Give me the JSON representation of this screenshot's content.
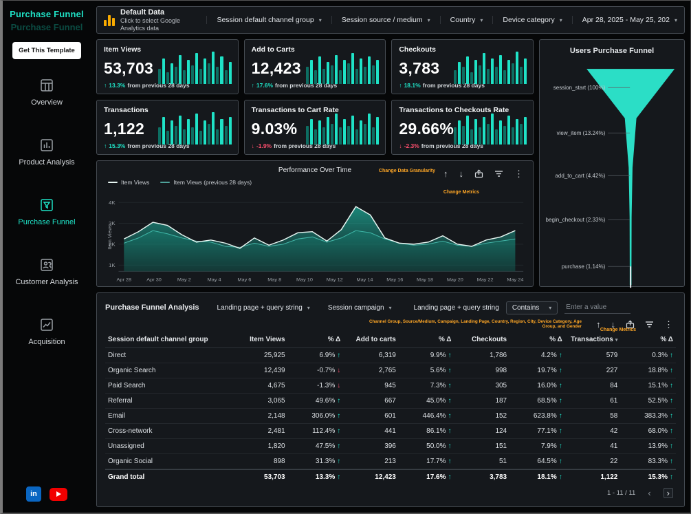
{
  "sidebar": {
    "title": "Purchase Funnel",
    "ghost_title": "Purchase Funnel",
    "template_button": "Get This Template",
    "items": [
      {
        "label": "Overview",
        "active": false
      },
      {
        "label": "Product Analysis",
        "active": false
      },
      {
        "label": "Purchase Funnel",
        "active": true
      },
      {
        "label": "Customer Analysis",
        "active": false
      },
      {
        "label": "Acquisition",
        "active": false
      }
    ],
    "social": {
      "linkedin_label": "in"
    }
  },
  "topbar": {
    "data_source_title": "Default Data",
    "data_source_subtitle": "Click to select Google Analytics data",
    "filters": [
      "Session default channel group",
      "Session source / medium",
      "Country",
      "Device category"
    ],
    "date_range": "Apr 28, 2025 - May 25, 202"
  },
  "kpis": [
    {
      "title": "Item Views",
      "value": "53,703",
      "delta": "13.3%",
      "direction": "up",
      "delta_note": "from previous 28 days",
      "spark": [
        0.45,
        0.75,
        0.35,
        0.6,
        0.5,
        0.85,
        0.4,
        0.7,
        0.55,
        0.9,
        0.45,
        0.75,
        0.6,
        0.95,
        0.5,
        0.8,
        0.4,
        0.65
      ]
    },
    {
      "title": "Add to Carts",
      "value": "12,423",
      "delta": "17.6%",
      "direction": "up",
      "delta_note": "from previous 28 days",
      "spark": [
        0.5,
        0.7,
        0.4,
        0.8,
        0.45,
        0.65,
        0.55,
        0.85,
        0.4,
        0.7,
        0.6,
        0.9,
        0.45,
        0.75,
        0.5,
        0.8,
        0.55,
        0.7
      ]
    },
    {
      "title": "Checkouts",
      "value": "3,783",
      "delta": "18.1%",
      "direction": "up",
      "delta_note": "from previous 28 days",
      "spark": [
        0.4,
        0.65,
        0.5,
        0.8,
        0.35,
        0.7,
        0.55,
        0.9,
        0.45,
        0.75,
        0.5,
        0.85,
        0.4,
        0.7,
        0.6,
        0.95,
        0.5,
        0.75
      ]
    },
    {
      "title": "Transactions",
      "value": "1,122",
      "delta": "15.3%",
      "direction": "up",
      "delta_note": "from previous 28 days",
      "spark": [
        0.5,
        0.8,
        0.4,
        0.7,
        0.55,
        0.85,
        0.45,
        0.75,
        0.5,
        0.9,
        0.4,
        0.7,
        0.6,
        0.95,
        0.45,
        0.75,
        0.55,
        0.8
      ]
    },
    {
      "title": "Transactions to Cart Rate",
      "value": "9.03%",
      "delta": "-1.9%",
      "direction": "down",
      "delta_note": "from previous 28 days",
      "spark": [
        0.55,
        0.75,
        0.45,
        0.7,
        0.5,
        0.8,
        0.6,
        0.9,
        0.5,
        0.75,
        0.55,
        0.85,
        0.45,
        0.7,
        0.6,
        0.9,
        0.5,
        0.8
      ]
    },
    {
      "title": "Transactions to Checkouts Rate",
      "value": "29.66%",
      "delta": "-2.3%",
      "direction": "down",
      "delta_note": "from previous 28 days",
      "spark": [
        0.5,
        0.7,
        0.55,
        0.85,
        0.45,
        0.75,
        0.5,
        0.8,
        0.6,
        0.9,
        0.45,
        0.7,
        0.55,
        0.85,
        0.5,
        0.75,
        0.6,
        0.8
      ]
    }
  ],
  "funnel": {
    "title": "Users Purchase Funnel",
    "color": "#2BDEC6",
    "stages": [
      {
        "label": "session_start (100%)",
        "pct": 100
      },
      {
        "label": "view_item (13.24%)",
        "pct": 13.24
      },
      {
        "label": "add_to_cart (4.42%)",
        "pct": 4.42
      },
      {
        "label": "begin_checkout (2.33%)",
        "pct": 2.33
      },
      {
        "label": "purchase (1.14%)",
        "pct": 1.14
      }
    ]
  },
  "performance_chart": {
    "title": "Performance Over Time",
    "y_axis_title": "Item Views",
    "legend": [
      {
        "label": "Item Views",
        "swatch": "#e8f6f2"
      },
      {
        "label": "Item Views (previous 28 days)",
        "swatch": "#4fa29a"
      }
    ],
    "annotations": {
      "granularity": "Change Data Granularity",
      "metrics": "Change Metrics"
    },
    "colors": {
      "current_line": "#e8f6f2",
      "current_fill": "#1fe0c4",
      "prev_line": "#4fa29a",
      "prev_fill": "#0f5c52"
    },
    "chart_data": {
      "type": "area",
      "x_labels": [
        "Apr 28",
        "Apr 30",
        "May 2",
        "May 4",
        "May 6",
        "May 8",
        "May 10",
        "May 12",
        "May 14",
        "May 16",
        "May 18",
        "May 20",
        "May 22",
        "May 24"
      ],
      "y_ticks": [
        {
          "value": 1000,
          "label": "1K"
        },
        {
          "value": 2000,
          "label": "2K"
        },
        {
          "value": 3000,
          "label": "3K"
        },
        {
          "value": 4000,
          "label": "4K"
        }
      ],
      "y_min": 700,
      "y_max": 4300,
      "series": [
        {
          "name": "Item Views",
          "values": [
            2250,
            2600,
            3050,
            2900,
            2450,
            2100,
            2200,
            2050,
            1800,
            2300,
            1950,
            2200,
            2550,
            2600,
            2150,
            2700,
            3800,
            3400,
            2300,
            2050,
            2000,
            2100,
            2400,
            2000,
            1900,
            2200,
            2350,
            2650
          ]
        },
        {
          "name": "Item Views (previous 28 days)",
          "values": [
            2050,
            2300,
            2650,
            2500,
            2300,
            2150,
            2100,
            1900,
            1850,
            2050,
            1900,
            2000,
            2250,
            2350,
            2100,
            2300,
            2650,
            2550,
            2250,
            2050,
            1950,
            2000,
            2150,
            1950,
            1900,
            2050,
            2150,
            2250
          ]
        }
      ]
    }
  },
  "table": {
    "title": "Purchase Funnel Analysis",
    "filter_dropdowns": [
      "Landing page + query string",
      "Session campaign"
    ],
    "condition_field_label": "Landing page + query string",
    "condition_operator": "Contains",
    "value_placeholder": "Enter a value",
    "annotations": {
      "dimensions": "Channel Group, Source/Medium, Campaign, Landing Page, Country, Region, City, Device Category, Age Group, and Gender",
      "metrics": "Change Metrics"
    },
    "columns": [
      {
        "label": "Session default channel group"
      },
      {
        "label": "Item Views"
      },
      {
        "label": "% Δ"
      },
      {
        "label": "Add to carts"
      },
      {
        "label": "% Δ"
      },
      {
        "label": "Checkouts"
      },
      {
        "label": "% Δ"
      },
      {
        "label": "Transactions",
        "sort": true
      },
      {
        "label": "% Δ"
      }
    ],
    "rows": [
      {
        "name": "Direct",
        "values": [
          "25,925",
          "6.9%",
          "6,319",
          "9.9%",
          "1,786",
          "4.2%",
          "579",
          "0.3%"
        ],
        "dirs": [
          "up",
          "up",
          "up",
          "up"
        ],
        "total": false
      },
      {
        "name": "Organic Search",
        "values": [
          "12,439",
          "-0.7%",
          "2,765",
          "5.6%",
          "998",
          "19.7%",
          "227",
          "18.8%"
        ],
        "dirs": [
          "down",
          "up",
          "up",
          "up"
        ],
        "total": false
      },
      {
        "name": "Paid Search",
        "values": [
          "4,675",
          "-1.3%",
          "945",
          "7.3%",
          "305",
          "16.0%",
          "84",
          "15.1%"
        ],
        "dirs": [
          "down",
          "up",
          "up",
          "up"
        ],
        "total": false
      },
      {
        "name": "Referral",
        "values": [
          "3,065",
          "49.6%",
          "667",
          "45.0%",
          "187",
          "68.5%",
          "61",
          "52.5%"
        ],
        "dirs": [
          "up",
          "up",
          "up",
          "up"
        ],
        "total": false
      },
      {
        "name": "Email",
        "values": [
          "2,148",
          "306.0%",
          "601",
          "446.4%",
          "152",
          "623.8%",
          "58",
          "383.3%"
        ],
        "dirs": [
          "up",
          "up",
          "up",
          "up"
        ],
        "total": false
      },
      {
        "name": "Cross-network",
        "values": [
          "2,481",
          "112.4%",
          "441",
          "86.1%",
          "124",
          "77.1%",
          "42",
          "68.0%"
        ],
        "dirs": [
          "up",
          "up",
          "up",
          "up"
        ],
        "total": false
      },
      {
        "name": "Unassigned",
        "values": [
          "1,820",
          "47.5%",
          "396",
          "50.0%",
          "151",
          "7.9%",
          "41",
          "13.9%"
        ],
        "dirs": [
          "up",
          "up",
          "up",
          "up"
        ],
        "total": false
      },
      {
        "name": "Organic Social",
        "values": [
          "898",
          "31.3%",
          "213",
          "17.7%",
          "51",
          "64.5%",
          "22",
          "83.3%"
        ],
        "dirs": [
          "up",
          "up",
          "up",
          "up"
        ],
        "total": false
      },
      {
        "name": "Grand total",
        "values": [
          "53,703",
          "13.3%",
          "12,423",
          "17.6%",
          "3,783",
          "18.1%",
          "1,122",
          "15.3%"
        ],
        "dirs": [
          "up",
          "up",
          "up",
          "up"
        ],
        "total": true
      }
    ],
    "pagination": "1 - 11 / 11"
  }
}
